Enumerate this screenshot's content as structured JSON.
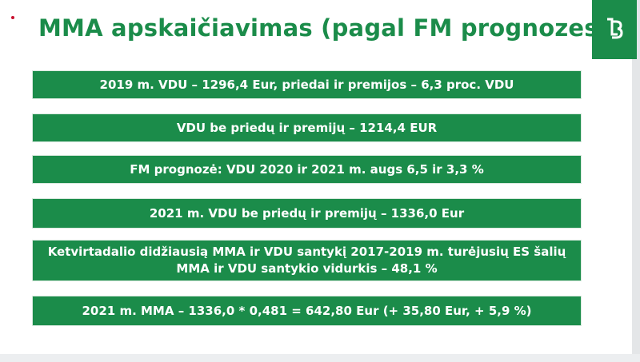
{
  "slide": {
    "title": "MMA apskaičiavimas (pagal FM prognozes)",
    "logo_icon": "lb-logo-icon",
    "accent_color": "#1b8c4a"
  },
  "boxes": [
    "2019 m. VDU – 1296,4 Eur, priedai ir premijos – 6,3 proc. VDU",
    "VDU be priedų ir premijų – 1214,4 EUR",
    "FM prognozė: VDU 2020 ir 2021 m. augs 6,5 ir 3,3 %",
    "2021 m. VDU be priedų ir premijų – 1336,0 Eur",
    "Ketvirtadalio didžiausią MMA ir VDU santykį 2017-2019 m. turėjusių ES šalių MMA ir VDU santykio vidurkis – 48,1 %",
    "2021 m. MMA – 1336,0 * 0,481 = 642,80 Eur (+ 35,80 Eur, + 5,9 %)"
  ]
}
